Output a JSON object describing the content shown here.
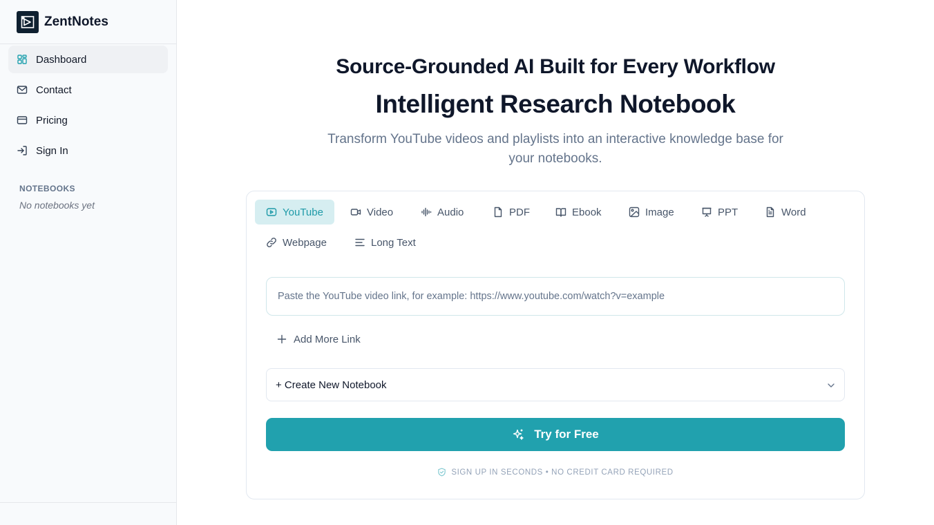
{
  "app": {
    "name": "ZentNotes"
  },
  "sidebar": {
    "items": [
      {
        "label": "Dashboard",
        "icon": "dashboard-icon",
        "active": true
      },
      {
        "label": "Contact",
        "icon": "mail-icon",
        "active": false
      },
      {
        "label": "Pricing",
        "icon": "credit-card-icon",
        "active": false
      },
      {
        "label": "Sign In",
        "icon": "sign-in-icon",
        "active": false
      }
    ],
    "notebooks_header": "NOTEBOOKS",
    "notebooks_empty": "No notebooks yet"
  },
  "hero": {
    "headline": "Source-Grounded AI Built for Every Workflow",
    "title": "Intelligent Research Notebook",
    "subtitle": "Transform YouTube videos and playlists into an interactive knowledge base for your notebooks."
  },
  "tabs": [
    {
      "label": "YouTube",
      "icon": "youtube-icon",
      "active": true
    },
    {
      "label": "Video",
      "icon": "video-camera-icon",
      "active": false
    },
    {
      "label": "Audio",
      "icon": "audio-waveform-icon",
      "active": false
    },
    {
      "label": "PDF",
      "icon": "file-icon",
      "active": false
    },
    {
      "label": "Ebook",
      "icon": "book-icon",
      "active": false
    },
    {
      "label": "Image",
      "icon": "image-icon",
      "active": false
    },
    {
      "label": "PPT",
      "icon": "presentation-icon",
      "active": false
    },
    {
      "label": "Word",
      "icon": "document-text-icon",
      "active": false
    },
    {
      "label": "Webpage",
      "icon": "link-icon",
      "active": false
    },
    {
      "label": "Long Text",
      "icon": "text-lines-icon",
      "active": false
    }
  ],
  "form": {
    "link_placeholder": "Paste the YouTube video link, for example: https://www.youtube.com/watch?v=example",
    "link_value": "",
    "add_more_label": "Add More Link",
    "notebook_select": "+ Create New Notebook",
    "cta_label": "Try for Free",
    "note": "SIGN UP IN SECONDS • NO CREDIT CARD REQUIRED"
  },
  "colors": {
    "accent": "#21a1ae",
    "accent_soft": "#d6eef1",
    "sidebar_bg": "#f8fafc",
    "text_primary": "#0f172a",
    "text_muted": "#64748b"
  }
}
